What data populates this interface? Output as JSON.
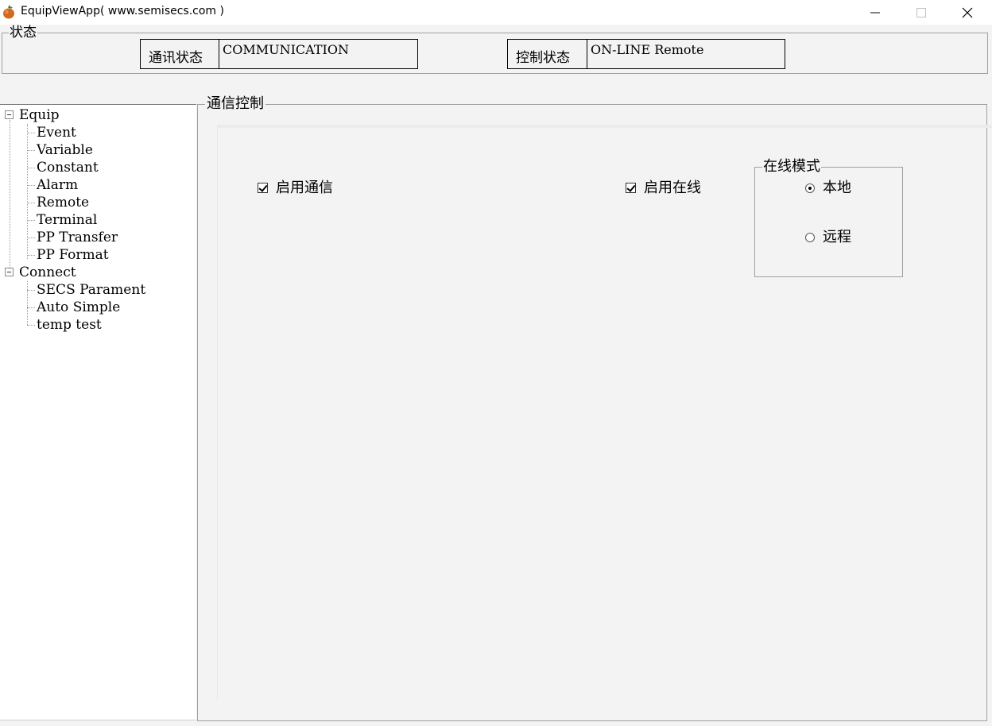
{
  "window": {
    "title": "EquipViewApp( www.semisecs.com )",
    "icon": "apple-icon",
    "controls": [
      "minimize-icon",
      "maximize-icon",
      "close-icon"
    ]
  },
  "status": {
    "legend": "状态",
    "comm_label": "通讯状态",
    "comm_value": "COMMUNICATION",
    "control_label": "控制状态",
    "control_value": "ON-LINE Remote"
  },
  "tree": {
    "nodes": [
      {
        "label": "Equip",
        "expanded": true,
        "children": [
          "Event",
          "Variable",
          "Constant",
          "Alarm",
          "Remote",
          "Terminal",
          "PP Transfer",
          "PP Format"
        ]
      },
      {
        "label": "Connect",
        "expanded": true,
        "children": [
          "SECS Parament",
          "Auto Simple",
          "temp test"
        ]
      }
    ]
  },
  "comm_control": {
    "legend": "通信控制",
    "enable_comm": {
      "label": "启用通信",
      "checked": true
    },
    "enable_online": {
      "label": "启用在线",
      "checked": true
    },
    "online_mode": {
      "legend": "在线模式",
      "options": [
        {
          "label": "本地",
          "selected": true
        },
        {
          "label": "远程",
          "selected": false
        }
      ]
    }
  }
}
